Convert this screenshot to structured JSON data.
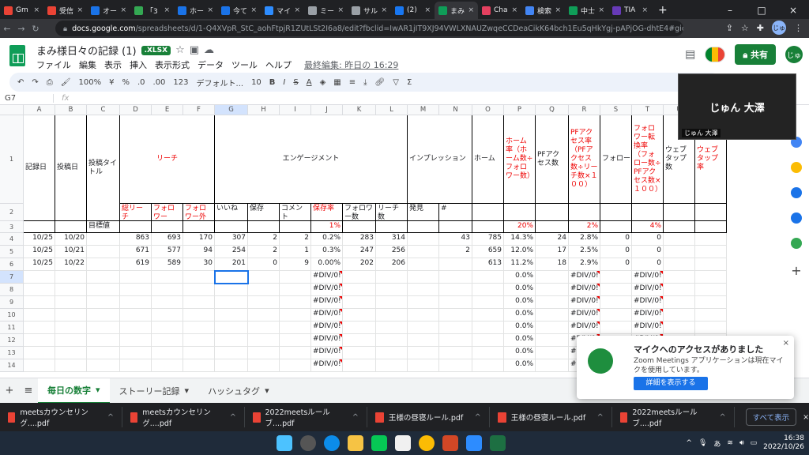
{
  "browser": {
    "tabs": [
      {
        "label": "Gm",
        "color": "#ea4335"
      },
      {
        "label": "受信",
        "color": "#ea4335"
      },
      {
        "label": "オー",
        "color": "#1a73e8"
      },
      {
        "label": "「3",
        "color": "#34a853"
      },
      {
        "label": "ホー",
        "color": "#1a73e8"
      },
      {
        "label": "今て",
        "color": "#1a73e8"
      },
      {
        "label": "マイ",
        "color": "#2d8cff"
      },
      {
        "label": "ミー",
        "color": "#9aa0a6"
      },
      {
        "label": "サル",
        "color": "#9aa0a6"
      },
      {
        "label": "(2)",
        "color": "#1877f2"
      },
      {
        "label": "まみ",
        "color": "#0f9d58",
        "active": true
      },
      {
        "label": "Cha",
        "color": "#e4405f"
      },
      {
        "label": "検索",
        "color": "#4285f4"
      },
      {
        "label": "中士",
        "color": "#0f9d58"
      },
      {
        "label": "TIA",
        "color": "#673ab7"
      }
    ],
    "url_host": "docs.google.com",
    "url_path": "/spreadsheets/d/1-Q4XVpR_StC_aohFtpjR1ZUtLSt2I6a8/edit?fbclid=IwAR1jIT9XJ94VWLXNAUZwqeCCDeaCikK64bch1Eu5qHkYgj-pAPjOG-dhtE4#gid=405791756",
    "user_initial": "じゅ"
  },
  "doc": {
    "title": "まみ様日々の記録 (1)",
    "badge": ".XLSX",
    "menus": [
      "ファイル",
      "編集",
      "表示",
      "挿入",
      "表示形式",
      "データ",
      "ツール",
      "ヘルプ"
    ],
    "last_edit": "最終編集: 昨日の 16:29",
    "share": "共有",
    "avatar": "じゅ"
  },
  "toolbar": {
    "zoom": "100%",
    "currency": "¥",
    "percent": "%",
    "dec1": ".0",
    "dec2": ".00",
    "fmt": "123",
    "font": "デフォルト...",
    "size": "10",
    "bold": "B",
    "italic": "I",
    "strike": "S",
    "color": "A"
  },
  "formula": {
    "cellref": "G7",
    "fx": "fx"
  },
  "columns": [
    "A",
    "B",
    "C",
    "D",
    "E",
    "F",
    "G",
    "H",
    "I",
    "J",
    "K",
    "L",
    "M",
    "N",
    "O",
    "P",
    "Q",
    "R",
    "S",
    "T",
    "U",
    "V"
  ],
  "headers": {
    "kiroku": "記録日",
    "toukou": "投稿日",
    "title": "投稿タイトル",
    "reach": "リーチ",
    "engage": "エンゲージメント",
    "impression": "インプレッション",
    "home": "ホーム",
    "homerate": "ホーム率（ホーム数÷フォロワー数）",
    "pfaccess": "PFアクセス数",
    "pfrate": "PFアクセス率（PFアクセス数÷リーチ数×１００）",
    "follower": "フォロー",
    "convrate": "フォロワー転換率（フォロー数÷PFアクセス数×１００）",
    "webtap": "ウェブタップ数",
    "webrate": "ウェブタップ率",
    "r2": [
      "総リーチ",
      "フォロワー",
      "フォロワー外",
      "いいね",
      "保存",
      "コメント",
      "保存率",
      "フォロワー数",
      "リーチ数",
      "発見",
      "#"
    ],
    "target_label": "目標値",
    "t_j": "1%",
    "t_p": "20%",
    "t_r": "2%",
    "t_t": "4%"
  },
  "rows": [
    {
      "a": "10/25",
      "b": "10/20",
      "d": "863",
      "e": "693",
      "f": "170",
      "g": "307",
      "h": "2",
      "i": "2",
      "j": "0.2%",
      "k": "283",
      "l": "314",
      "n": "43",
      "o": "785",
      "p": "14.3%",
      "q": "24",
      "r": "2.8%",
      "s": "0",
      "t": "0"
    },
    {
      "a": "10/25",
      "b": "10/21",
      "d": "671",
      "e": "577",
      "f": "94",
      "g": "254",
      "h": "2",
      "i": "1",
      "j": "0.3%",
      "k": "247",
      "l": "256",
      "n": "2",
      "o": "659",
      "p": "12.0%",
      "q": "17",
      "r": "2.5%",
      "s": "0",
      "t": "0"
    },
    {
      "a": "10/25",
      "b": "10/22",
      "d": "619",
      "e": "589",
      "f": "30",
      "g": "201",
      "h": "0",
      "i": "9",
      "j": "0.00%",
      "k": "202",
      "l": "206",
      "n": "",
      "o": "613",
      "p": "11.2%",
      "q": "18",
      "r": "2.9%",
      "s": "0",
      "t": "0"
    }
  ],
  "empty_rows": [
    "7",
    "8",
    "9",
    "10",
    "11",
    "12",
    "13",
    "14"
  ],
  "div0": "#DIV/0!",
  "zero_pct": "0.0%",
  "zero": "0",
  "sheet_tabs": [
    "毎日の数字",
    "ストーリー記録",
    "ハッシュタグ"
  ],
  "downloads": [
    "meetsカウンセリング....pdf",
    "meetsカウンセリング....pdf",
    "2022meetsルールブ....pdf",
    "王様の昼寝ルール.pdf",
    "王様の昼寝ルール.pdf",
    "2022meetsルールブ....pdf"
  ],
  "show_all": "すべて表示",
  "zoom": {
    "name": "じゅん 大澤",
    "tag": "じゅん 大澤"
  },
  "toast": {
    "title": "マイクへのアクセスがありました",
    "message": "Zoom Meetings アプリケーションは現在マイクを使用しています。",
    "button": "詳細を表示する",
    "close": "×"
  },
  "clock": {
    "time": "16:38",
    "date": "2022/10/26"
  }
}
